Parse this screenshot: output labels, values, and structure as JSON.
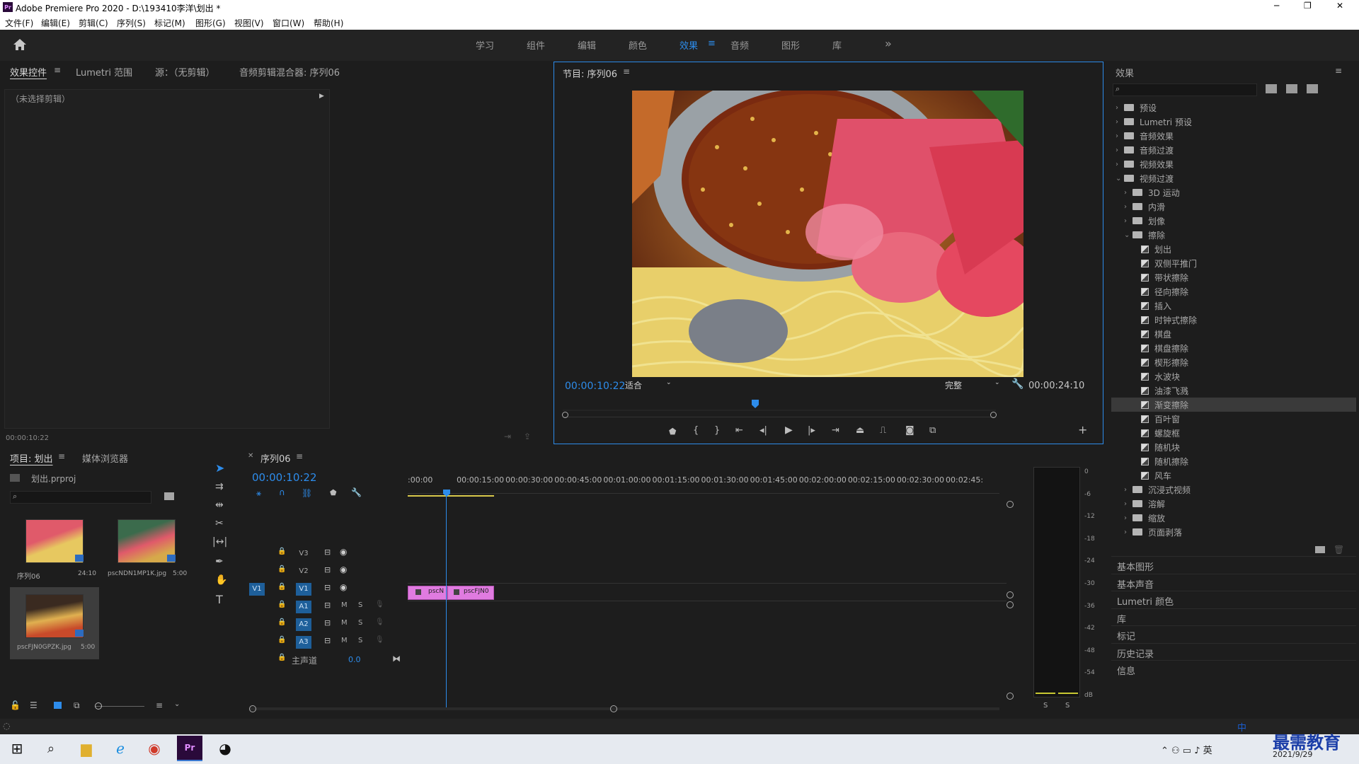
{
  "titlebar": {
    "app_logo": "Pr",
    "title": "Adobe Premiere Pro 2020 - D:\\193410李洋\\划出 *",
    "minimize": "─",
    "maximize": "❐",
    "close": "✕"
  },
  "menu": [
    "文件(F)",
    "编辑(E)",
    "剪辑(C)",
    "序列(S)",
    "标记(M)",
    "图形(G)",
    "视图(V)",
    "窗口(W)",
    "帮助(H)"
  ],
  "workspaces": [
    "学习",
    "组件",
    "编辑",
    "颜色",
    "效果",
    "音频",
    "图形",
    "库"
  ],
  "workspace_active": "效果",
  "workspace_more": "»",
  "effect_controls": {
    "tabs": [
      "效果控件",
      "Lumetri 范围",
      "源：（无剪辑）",
      "音频剪辑混合器: 序列06"
    ],
    "no_clip": "（未选择剪辑）",
    "timecode": "00:00:10:22"
  },
  "program": {
    "title": "节目: 序列06",
    "timecode": "00:00:10:22",
    "fit": "适合",
    "quality": "完整",
    "duration": "00:00:24:10"
  },
  "project": {
    "tabs": [
      "项目: 划出",
      "媒体浏览器"
    ],
    "project_file": "划出.prproj",
    "items": [
      {
        "name": "序列06",
        "meta": "24:10"
      },
      {
        "name": "pscNDN1MP1K.jpg",
        "meta": "5:00"
      },
      {
        "name": "pscFJN0GPZK.jpg",
        "meta": "5:00"
      }
    ]
  },
  "timeline": {
    "tab": "序列06",
    "timecode": "00:00:10:22",
    "ruler": [
      ":00:00",
      "00:00:15:00",
      "00:00:30:00",
      "00:00:45:00",
      "00:01:00:00",
      "00:01:15:00",
      "00:01:30:00",
      "00:01:45:00",
      "00:02:00:00",
      "00:02:15:00",
      "00:02:30:00",
      "00:02:45:"
    ],
    "video_tracks": [
      "V3",
      "V2",
      "V1"
    ],
    "audio_tracks": [
      "A1",
      "A2",
      "A3"
    ],
    "source_patch": "V1",
    "master_label": "主声道",
    "master_value": "0.0",
    "clips": [
      "pscN",
      "pscFJN0"
    ]
  },
  "meter": {
    "scale": [
      "0",
      "-6",
      "-12",
      "-18",
      "-24",
      "-30",
      "-36",
      "-42",
      "-48",
      "-54",
      "dB"
    ],
    "solo": [
      "S",
      "S"
    ]
  },
  "effects": {
    "title": "效果",
    "tree": [
      {
        "label": "预设",
        "level": 0,
        "kind": "folder",
        "open": false
      },
      {
        "label": "Lumetri 预设",
        "level": 0,
        "kind": "folder",
        "open": false
      },
      {
        "label": "音频效果",
        "level": 0,
        "kind": "folder",
        "open": false
      },
      {
        "label": "音频过渡",
        "level": 0,
        "kind": "folder",
        "open": false
      },
      {
        "label": "视频效果",
        "level": 0,
        "kind": "folder",
        "open": false
      },
      {
        "label": "视频过渡",
        "level": 0,
        "kind": "folder",
        "open": true
      },
      {
        "label": "3D 运动",
        "level": 1,
        "kind": "folder",
        "open": false
      },
      {
        "label": "内滑",
        "level": 1,
        "kind": "folder",
        "open": false
      },
      {
        "label": "划像",
        "level": 1,
        "kind": "folder",
        "open": false
      },
      {
        "label": "擦除",
        "level": 1,
        "kind": "folder",
        "open": true
      },
      {
        "label": "划出",
        "level": 2,
        "kind": "fx"
      },
      {
        "label": "双侧平推门",
        "level": 2,
        "kind": "fx"
      },
      {
        "label": "带状擦除",
        "level": 2,
        "kind": "fx"
      },
      {
        "label": "径向擦除",
        "level": 2,
        "kind": "fx"
      },
      {
        "label": "插入",
        "level": 2,
        "kind": "fx"
      },
      {
        "label": "时钟式擦除",
        "level": 2,
        "kind": "fx"
      },
      {
        "label": "棋盘",
        "level": 2,
        "kind": "fx"
      },
      {
        "label": "棋盘擦除",
        "level": 2,
        "kind": "fx"
      },
      {
        "label": "楔形擦除",
        "level": 2,
        "kind": "fx"
      },
      {
        "label": "水波块",
        "level": 2,
        "kind": "fx"
      },
      {
        "label": "油漆飞溅",
        "level": 2,
        "kind": "fx"
      },
      {
        "label": "渐变擦除",
        "level": 2,
        "kind": "fx",
        "selected": true
      },
      {
        "label": "百叶窗",
        "level": 2,
        "kind": "fx"
      },
      {
        "label": "螺旋框",
        "level": 2,
        "kind": "fx"
      },
      {
        "label": "随机块",
        "level": 2,
        "kind": "fx"
      },
      {
        "label": "随机擦除",
        "level": 2,
        "kind": "fx"
      },
      {
        "label": "风车",
        "level": 2,
        "kind": "fx"
      },
      {
        "label": "沉浸式视频",
        "level": 1,
        "kind": "folder",
        "open": false
      },
      {
        "label": "溶解",
        "level": 1,
        "kind": "folder",
        "open": false
      },
      {
        "label": "缩放",
        "level": 1,
        "kind": "folder",
        "open": false
      },
      {
        "label": "页面剥落",
        "level": 1,
        "kind": "folder",
        "open": false
      }
    ],
    "panels": [
      "基本图形",
      "基本声音",
      "Lumetri 颜色",
      "库",
      "标记",
      "历史记录",
      "信息"
    ]
  },
  "taskbar": {
    "time": "...",
    "date": "2021/9/29",
    "ime": "中",
    "watermark": "最需教育"
  },
  "colors": {
    "accent": "#2d8ceb",
    "clip": "#e07be0",
    "selected_row": "#3a3a3a"
  }
}
